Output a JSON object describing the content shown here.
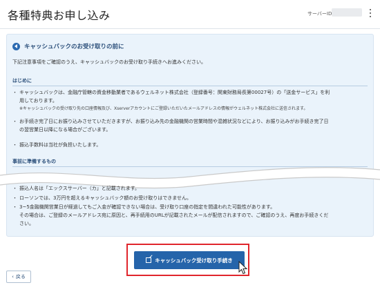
{
  "header": {
    "title": "各種特典お申し込み",
    "server_id_label": "サーバーID",
    "menu_icon": "kebab-menu-icon"
  },
  "notice": {
    "title": "キャッシュバックのお受け取りの前に",
    "title_icon": "arrow-left-circle-icon",
    "intro": "下記注意事項をご確認のうえ、キャッシュバックのお受け取り手続きへお進みください。",
    "sections": [
      {
        "heading": "はじめに",
        "bullets": [
          {
            "lines": [
              "キャッシュバックは、金融庁管轄の資金移動業者であるウェルネット株式会社（登録番号：関東財務局長第00027号）の「送金サービス」を利",
              "用しております。"
            ],
            "note": "※キャッシュバックの受け取り先の口座情報及び、Xserverアカウントにご登録いただいたメールアドレスの情報がウェルネット株式会社に送信されます。"
          },
          {
            "lines": [
              "お手続き完了日にお振り込みさせていただきますが、お振り込み先の金融機関の営業時間や混雑状況などにより、お振り込みがお手続き完了日",
              "の翌営業日以降になる場合がございます。"
            ]
          },
          {
            "lines": [
              "振込手数料は当社が負担いたします。"
            ]
          }
        ]
      },
      {
        "heading": "事前に準備するもの",
        "bullets": [
          {
            "lines": [
              "振込人名は「エックスサーバー（カ」と記載されます。"
            ]
          },
          {
            "lines": [
              "ローソンでは、3万円を超えるキャッシュバック額のお受け取りはできません。"
            ]
          },
          {
            "lines": [
              "3~5金融機関営業日が経過してもご入金が確認できない場合は、受け取り口座の指定を間違われた可能性があります。",
              "その場合は、ご登録のメールアドレス宛に原因と、再手続用のURLが記載されたメールが配信されますので、ご確認のうえ、再度お手続きくだ",
              "さい。"
            ]
          }
        ]
      }
    ]
  },
  "cta": {
    "label": "キャッシュバック受け取り手続き",
    "icon": "external-link-icon",
    "highlight_color": "#e0242b",
    "button_color": "#2564aa"
  },
  "back": {
    "label": "戻る",
    "icon": "chevron-left-icon"
  }
}
